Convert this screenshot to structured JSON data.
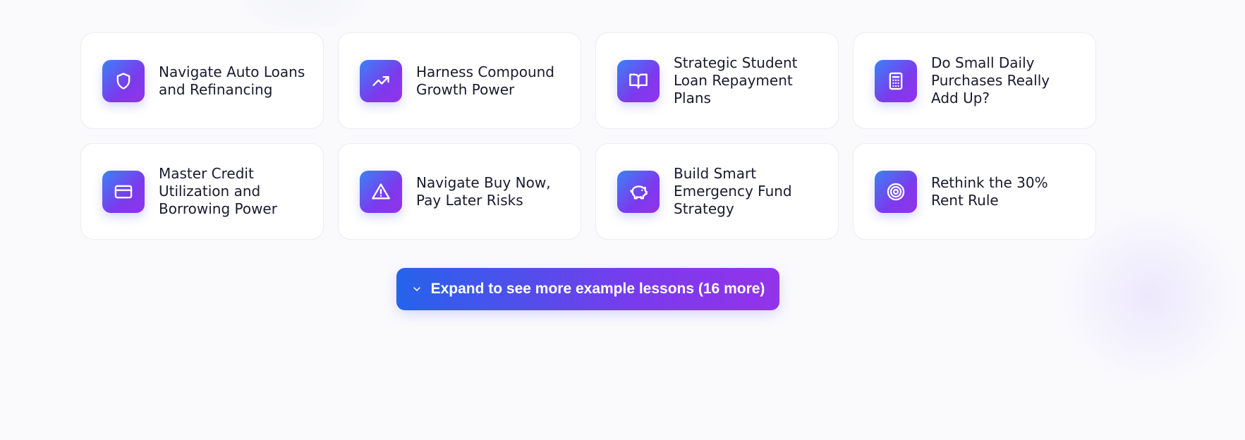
{
  "lessons": [
    {
      "title": "Navigate Auto Loans and Refinancing",
      "icon": "shield-icon"
    },
    {
      "title": "Harness Compound Growth Power",
      "icon": "trending-up-icon"
    },
    {
      "title": "Strategic Student Loan Repayment Plans",
      "icon": "book-open-icon"
    },
    {
      "title": "Do Small Daily Purchases Really Add Up?",
      "icon": "calculator-icon"
    },
    {
      "title": "Master Credit Utilization and Borrowing Power",
      "icon": "credit-card-icon"
    },
    {
      "title": "Navigate Buy Now, Pay Later Risks",
      "icon": "alert-triangle-icon"
    },
    {
      "title": "Build Smart Emergency Fund Strategy",
      "icon": "piggy-bank-icon"
    },
    {
      "title": "Rethink the 30% Rent Rule",
      "icon": "target-icon"
    }
  ],
  "expand": {
    "label": "Expand to see more example lessons (16 more)",
    "icon": "chevron-down-icon"
  },
  "colors": {
    "background": "#fafafd",
    "card_background": "#ffffff",
    "card_border": "#ececf2",
    "text": "#1a1a2e",
    "gradient_start": "#2563eb",
    "gradient_end": "#9333ea"
  }
}
